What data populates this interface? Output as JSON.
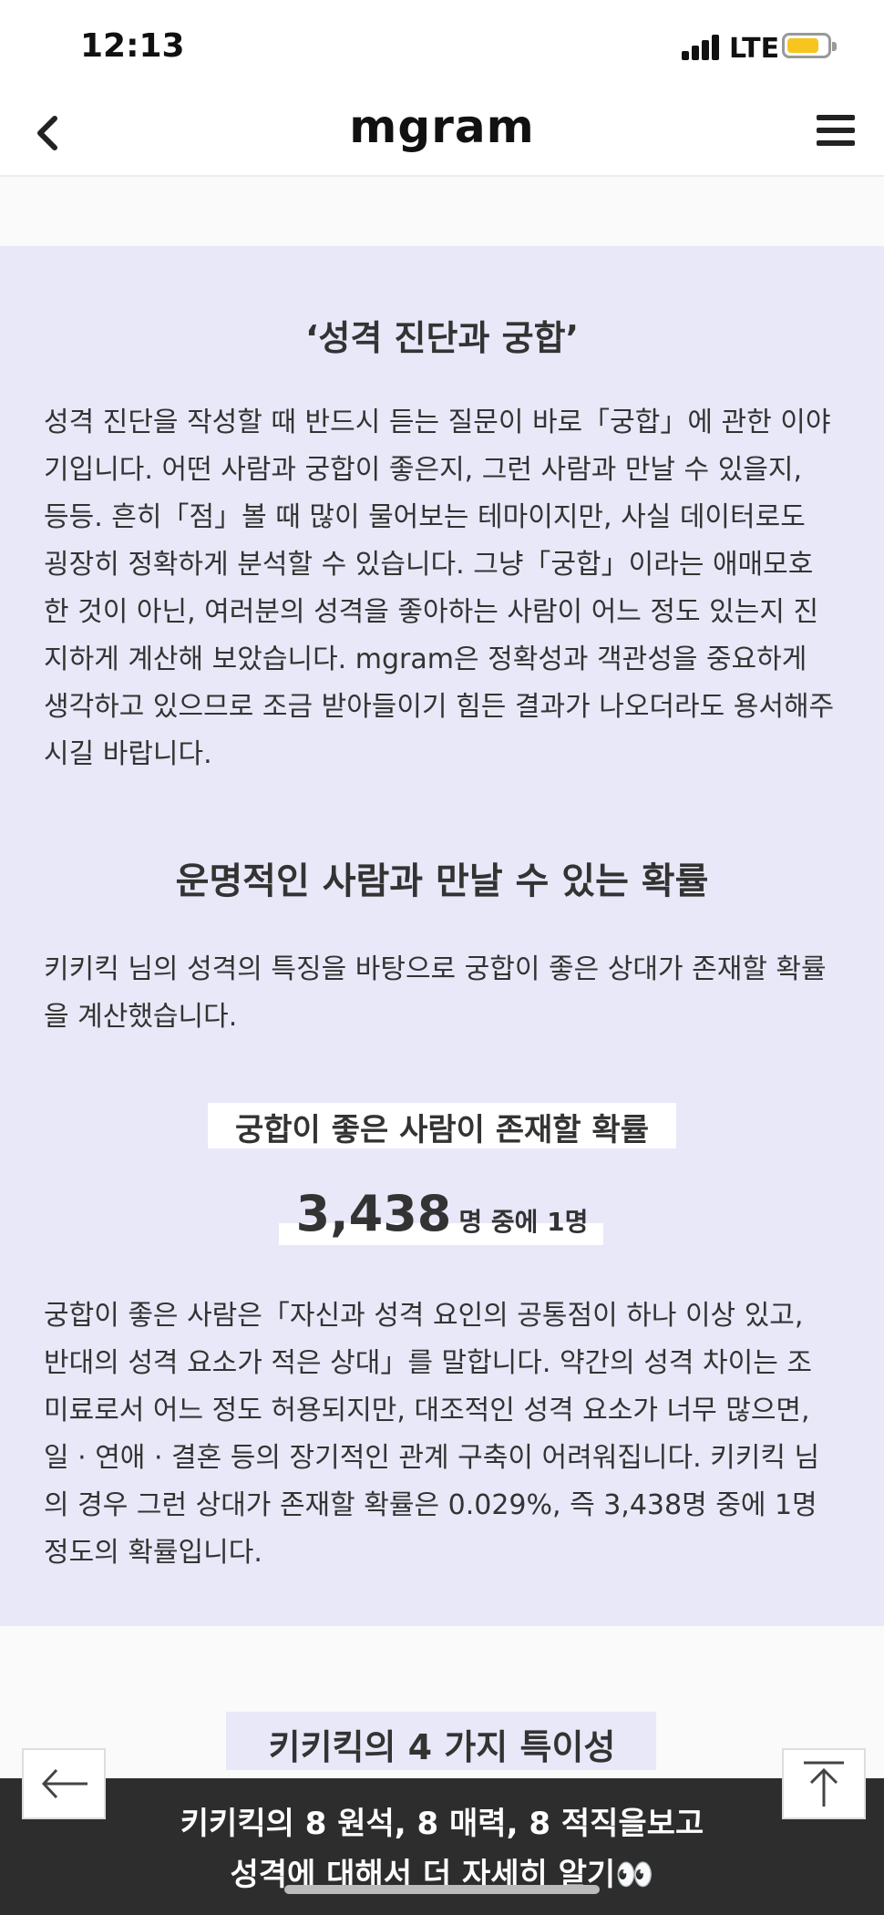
{
  "status": {
    "time": "12:13",
    "network": "LTE"
  },
  "header": {
    "brand": "mgram"
  },
  "section1": {
    "title": "‘성격 진단과 궁합’",
    "paragraph": "성격 진단을 작성할 때 반드시 듣는 질문이 바로「궁합」에 관한 이야기입니다. 어떤 사람과 궁합이 좋은지, 그런 사람과 만날 수 있을지, 등등. 흔히「점」볼 때 많이 물어보는 테마이지만, 사실 데이터로도 굉장히 정확하게 분석할 수 있습니다. 그냥「궁합」이라는 애매모호한 것이 아닌, 여러분의 성격을 좋아하는 사람이 어느 정도 있는지 진지하게 계산해 보았습니다. mgram은 정확성과 객관성을 중요하게 생각하고 있으므로 조금 받아들이기 힘든 결과가 나오더라도 용서해주시길 바랍니다."
  },
  "section2": {
    "title": "운명적인 사람과 만날 수 있는 확률",
    "intro": "키키킥 님의 성격의 특징을 바탕으로 궁합이 좋은 상대가 존재할 확률을 계산했습니다.",
    "probability_label": "궁합이 좋은 사람이 존재할 확률",
    "probability_number": "3,438",
    "probability_unit": "명 중에 1명",
    "explanation": "궁합이 좋은 사람은「자신과 성격 요인의 공통점이 하나 이상 있고, 반대의 성격 요소가 적은 상대」를 말합니다. 약간의 성격 차이는 조미료로서 어느 정도 허용되지만, 대조적인 성격 요소가 너무 많으면, 일 · 연애 · 결혼 등의 장기적인 관계 구축이 어려워집니다. 키키킥 님의 경우 그런 상대가 존재할 확률은 0.029%, 즉 3,438명 중에 1명 정도의 확률입니다."
  },
  "section3": {
    "title": "키키킥의 4 가지 특이성"
  },
  "cta": {
    "line1": "키키킥의 8 원석, 8 매력, 8 적직을보고",
    "line2": "성격에 대해서 더 자세히 알기👀"
  },
  "colors": {
    "panel_bg": "#e8e8f8",
    "cta_bg": "#2d2d2d",
    "battery": "#f7c51e"
  },
  "icons": {
    "back": "chevron-left-icon",
    "menu": "hamburger-icon",
    "prev": "arrow-left-icon",
    "top": "arrow-up-icon"
  }
}
